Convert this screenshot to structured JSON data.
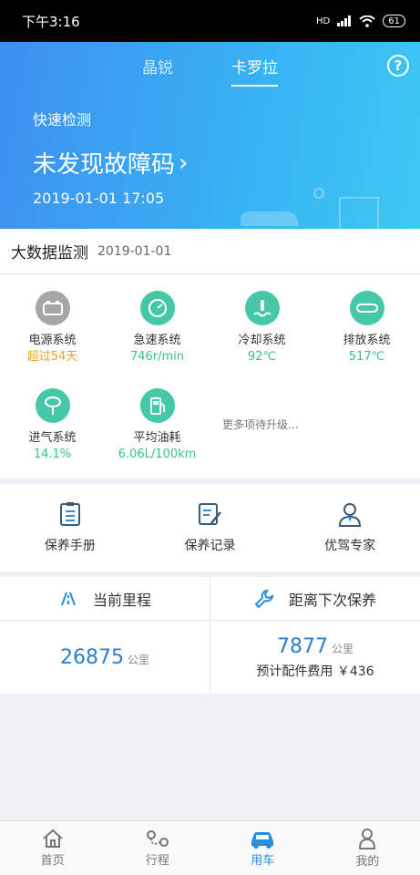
{
  "status_bar": {
    "time": "下午3:16",
    "network": "HD",
    "battery": "61"
  },
  "header": {
    "tabs": [
      {
        "label": "晶锐",
        "active": false
      },
      {
        "label": "卡罗拉",
        "active": true
      }
    ],
    "help_icon": "question-circle-icon"
  },
  "quick_check": {
    "label": "快速检测",
    "title": "未发现故障码",
    "arrow": "›",
    "time": "2019-01-01 17:05"
  },
  "monitor": {
    "title": "大数据监测",
    "date": "2019-01-01",
    "items": [
      {
        "name": "电源系统",
        "value": "超过54天",
        "icon": "battery-icon",
        "value_color": "#e9a623"
      },
      {
        "name": "急速系统",
        "value": "746r/min",
        "icon": "speedometer-icon",
        "value_color": "#3fbf95"
      },
      {
        "name": "冷却系统",
        "value": "92℃",
        "icon": "thermometer-icon",
        "value_color": "#3fbf95"
      },
      {
        "name": "排放系统",
        "value": "517℃",
        "icon": "exhaust-icon",
        "value_color": "#3fbf95"
      },
      {
        "name": "进气系统",
        "value": "14.1%",
        "icon": "intake-icon",
        "value_color": "#3fbf95"
      },
      {
        "name": "平均油耗",
        "value": "6.06L/100km",
        "icon": "fuel-pump-icon",
        "value_color": "#3fbf95"
      }
    ],
    "more": "更多项待升级..."
  },
  "services": [
    {
      "label": "保养手册",
      "icon": "manual-icon"
    },
    {
      "label": "保养记录",
      "icon": "record-icon"
    },
    {
      "label": "优驾专家",
      "icon": "expert-icon"
    }
  ],
  "mileage": {
    "current_label": "当前里程",
    "current_value": "26875",
    "current_unit": "公里",
    "next_label": "距离下次保养",
    "next_value": "7877",
    "next_unit": "公里",
    "fee": "预计配件费用 ￥436"
  },
  "nav": [
    {
      "label": "首页",
      "icon": "home-icon",
      "active": false
    },
    {
      "label": "行程",
      "icon": "route-icon",
      "active": false
    },
    {
      "label": "用车",
      "icon": "car-icon",
      "active": true
    },
    {
      "label": "我的",
      "icon": "user-icon",
      "active": false
    }
  ],
  "colors": {
    "accent": "#2a8cdf",
    "teal": "#46c8a8",
    "warning": "#e9a623"
  }
}
